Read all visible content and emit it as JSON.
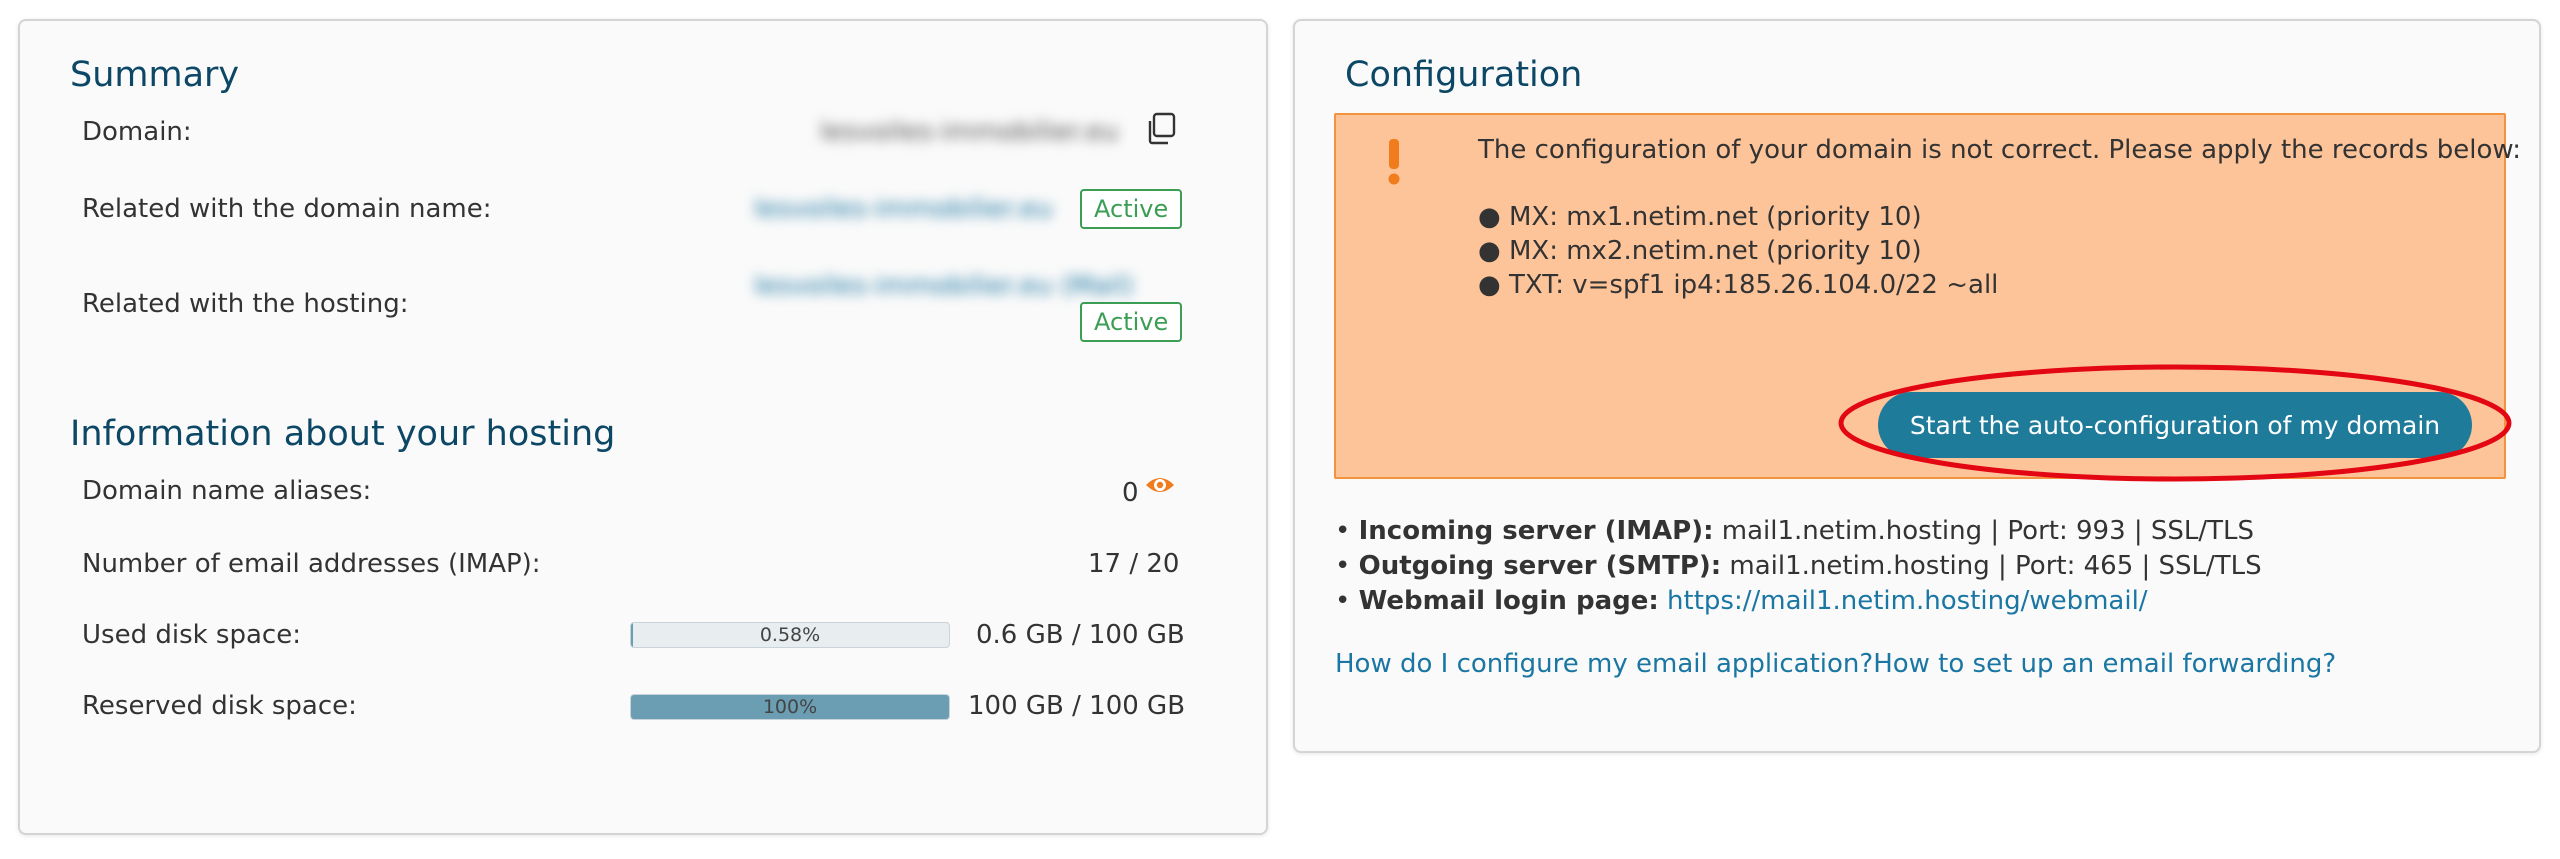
{
  "summary": {
    "title": "Summary",
    "domain_label": "Domain:",
    "domain_value": "lesvoiles-immobilier.eu",
    "related_domain_label": "Related with the domain name:",
    "related_domain_value": "lesvoiles-immobilier.eu",
    "related_domain_status": "Active",
    "related_hosting_label": "Related with the hosting:",
    "related_hosting_value": "lesvoiles-immobilier.eu (Mail)",
    "related_hosting_status": "Active"
  },
  "hosting": {
    "title": "Information about your hosting",
    "aliases_label": "Domain name aliases:",
    "aliases_value": "0",
    "email_label": "Number of email addresses (IMAP):",
    "email_value": "17 / 20",
    "used_disk_label": "Used disk space:",
    "used_disk_percent": 0.58,
    "used_disk_percent_text": "0.58%",
    "used_disk_value": "0.6 GB / 100 GB",
    "reserved_disk_label": "Reserved disk space:",
    "reserved_disk_percent": 100,
    "reserved_disk_percent_text": "100%",
    "reserved_disk_value": "100 GB / 100 GB"
  },
  "configuration": {
    "title": "Configuration",
    "alert_message": "The configuration of your domain is not correct. Please apply the records below:",
    "records": [
      "● MX: mx1.netim.net (priority 10)",
      "● MX: mx2.netim.net (priority 10)",
      "● TXT: v=spf1 ip4:185.26.104.0/22 ~all"
    ],
    "auto_config_button": "Start the auto-configuration of my domain",
    "incoming_label": "Incoming server (IMAP):",
    "incoming_value": "mail1.netim.hosting | Port: 993 | SSL/TLS",
    "outgoing_label": "Outgoing server (SMTP):",
    "outgoing_value": "mail1.netim.hosting | Port: 465 | SSL/TLS",
    "webmail_label": "Webmail login page:",
    "webmail_link": "https://mail1.netim.hosting/webmail/",
    "help_link_1": "How do I configure my email application?",
    "help_link_2": "How to set up an email forwarding?"
  },
  "colors": {
    "title": "#0d4766",
    "link": "#1a76a3",
    "active_badge": "#3b9e54",
    "alert_bg": "#fdc49a",
    "alert_border": "#f1943d",
    "warning_icon": "#f07c1e",
    "button": "#1f7b9a",
    "annotation": "#e30613",
    "progress_fill": "#6b9db3"
  },
  "icons": {
    "copy": "copy-icon",
    "eye": "eye-icon",
    "warning": "exclamation-icon"
  }
}
